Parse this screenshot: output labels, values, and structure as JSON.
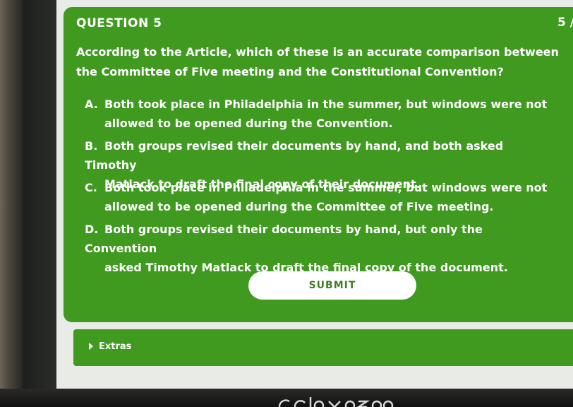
{
  "question": {
    "number_label": "QUESTION 5",
    "progress": "5 /",
    "prompt": "According to the Article, which of these is an accurate comparison between the Committee of Five meeting and the Constitutional Convention?",
    "choices": [
      {
        "letter": "A.",
        "line1": "Both took place in Philadelphia in the summer, but windows were not",
        "line2": "allowed to be opened during the Convention."
      },
      {
        "letter": "B.",
        "line1": "Both groups revised their documents by hand, and both asked Timothy",
        "line2": "Matlack to draft the final copy of their document."
      },
      {
        "letter": "C.",
        "line1": "Both took place in Philadelphia in the summer, but windows were not",
        "line2": "allowed to be opened during the Committee of Five meeting."
      },
      {
        "letter": "D.",
        "line1": "Both groups revised their documents by hand, but only the Convention",
        "line2": "asked Timothy Matlack to draft the final copy of the document."
      }
    ],
    "submit_label": "SUBMIT"
  },
  "extras": {
    "label": "Extras"
  },
  "colors": {
    "card_green": "#3f9a1f",
    "text_white": "#ffffff",
    "submit_text": "#3f7f25"
  },
  "icons": {
    "extras_toggle": "triangle-right-icon"
  }
}
